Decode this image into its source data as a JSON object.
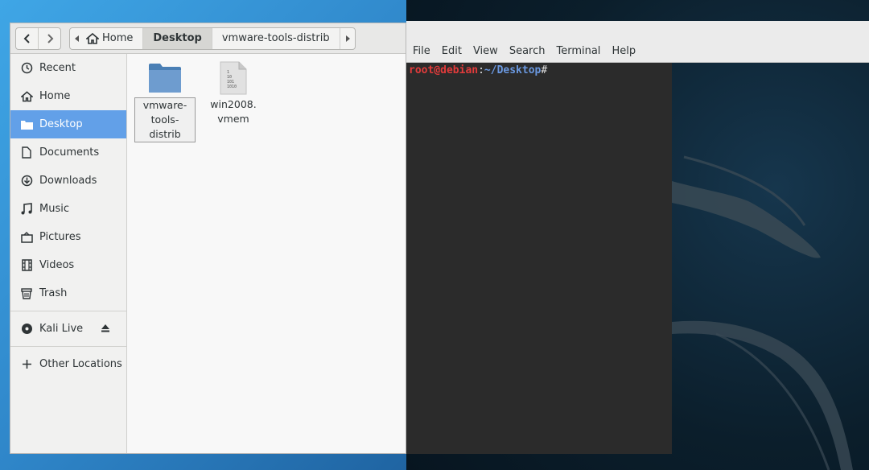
{
  "file_manager": {
    "nav": {
      "back_icon": "chevron-left",
      "forward_icon": "chevron-right"
    },
    "path": {
      "items": [
        {
          "label": "Home",
          "icon": "home-icon"
        },
        {
          "label": "Desktop",
          "active": true
        },
        {
          "label": "vmware-tools-distrib"
        }
      ]
    },
    "sidebar": {
      "items": [
        {
          "label": "Recent",
          "icon": "clock-icon"
        },
        {
          "label": "Home",
          "icon": "home-icon"
        },
        {
          "label": "Desktop",
          "icon": "folder-icon",
          "selected": true
        },
        {
          "label": "Documents",
          "icon": "document-icon"
        },
        {
          "label": "Downloads",
          "icon": "download-icon"
        },
        {
          "label": "Music",
          "icon": "music-icon"
        },
        {
          "label": "Pictures",
          "icon": "pictures-icon"
        },
        {
          "label": "Videos",
          "icon": "film-icon"
        },
        {
          "label": "Trash",
          "icon": "trash-icon"
        }
      ],
      "devices": [
        {
          "label": "Kali Live",
          "icon": "disc-icon",
          "eject_icon": "eject-icon"
        }
      ],
      "other": {
        "label": "Other Locations",
        "icon": "plus-icon"
      }
    },
    "files": [
      {
        "line1": "vmware-",
        "line2": "tools-distrib",
        "type": "folder",
        "selected": true
      },
      {
        "line1": "win2008.",
        "line2": "vmem",
        "type": "binary-file"
      }
    ]
  },
  "terminal": {
    "menu": [
      "File",
      "Edit",
      "View",
      "Search",
      "Terminal",
      "Help"
    ],
    "prompt": {
      "user_host": "root@debian",
      "colon": ":",
      "path": "~/Desktop",
      "symbol": "#"
    }
  },
  "colors": {
    "selection": "#62a0e8",
    "prompt_user": "#e23b3b",
    "prompt_path": "#6a98e0",
    "terminal_bg": "#2b2b2b"
  }
}
